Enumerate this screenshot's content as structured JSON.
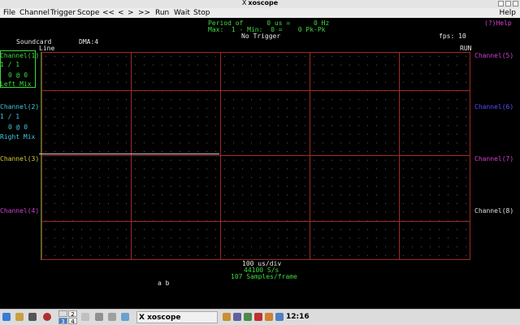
{
  "window": {
    "title": "xoscope",
    "title_glyph": "X"
  },
  "menu": {
    "items": [
      "File",
      "Channel",
      "Trigger",
      "Scope",
      "<<",
      "<",
      ">",
      ">>",
      "Run",
      "Wait",
      "Stop"
    ],
    "help": "Help"
  },
  "scope": {
    "period_line": "Period of      0 us =      0 Hz",
    "minmax_line": "Max:  1 - Min:  0 =    0 Pk-Pk",
    "trigger": "No Trigger",
    "help": "(?)Help",
    "source": "Soundcard",
    "dma": "DMA:4",
    "line_label": "Line",
    "fps": "fps: 10",
    "run": "RUN",
    "channels_left": [
      {
        "name": "Channel(1)",
        "scale": "1 / 1",
        "pos": "0 @ 0",
        "label": "Left Mix",
        "color": "#3ddc3d"
      },
      {
        "name": "Channel(2)",
        "scale": "1 / 1",
        "pos": "0 @ 0",
        "label": "Right Mix",
        "color": "#40c8e0"
      },
      {
        "name": "Channel(3)",
        "color": "#d8c838"
      },
      {
        "name": "Channel(4)",
        "color": "#d040d0"
      }
    ],
    "channels_right": [
      {
        "name": "Channel(5)",
        "color": "#d040d0"
      },
      {
        "name": "Channel(6)",
        "color": "#5050ff"
      },
      {
        "name": "Channel(7)",
        "color": "#d040d0"
      },
      {
        "name": "Channel(8)",
        "color": "#e0e0e0"
      }
    ],
    "timebase": "100 us/div",
    "rate": "44100 S/s",
    "samples": "107 Samples/frame",
    "math": "a b"
  },
  "taskbar": {
    "desktops": [
      "2",
      "3",
      "4"
    ],
    "task_title": "xoscope",
    "clock": "12:16"
  }
}
